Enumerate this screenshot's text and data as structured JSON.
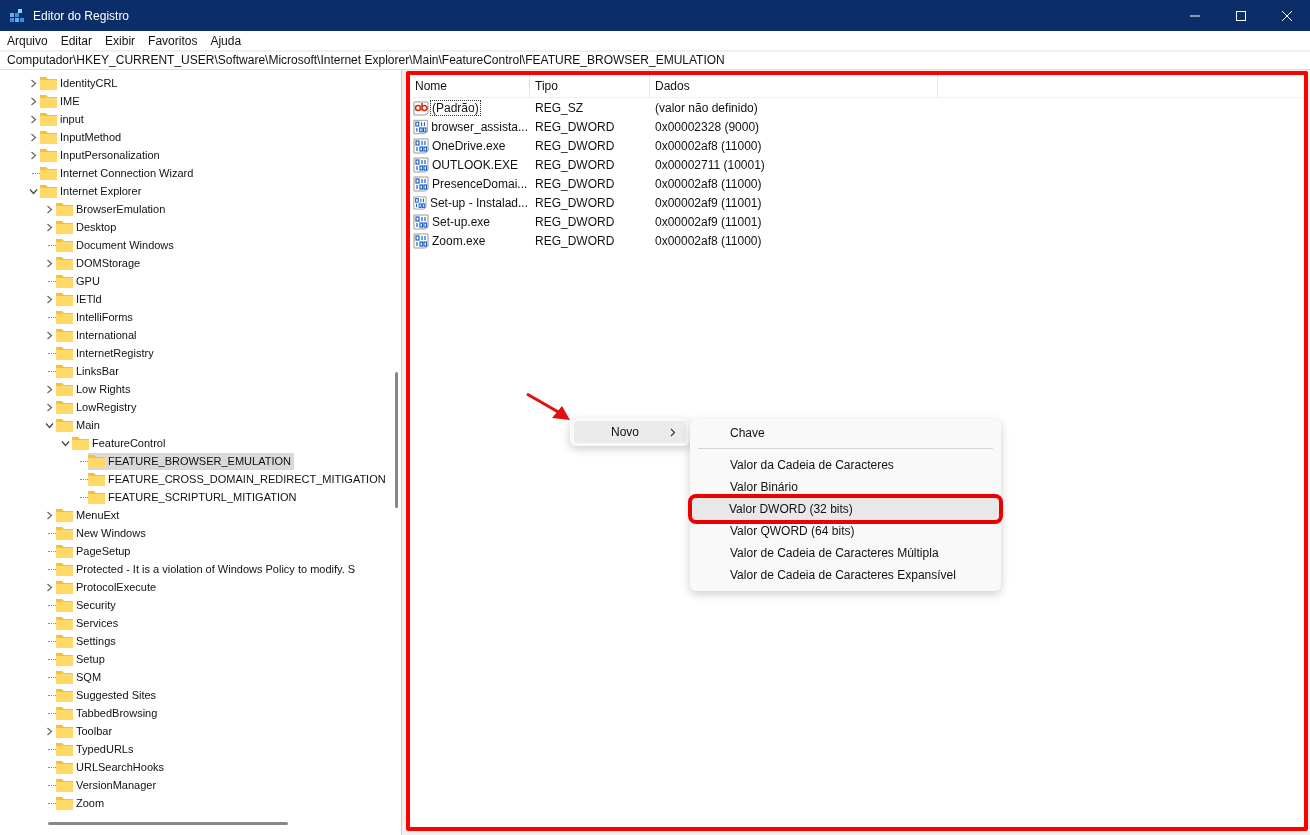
{
  "window": {
    "title": "Editor do Registro"
  },
  "menu": [
    "Arquivo",
    "Editar",
    "Exibir",
    "Favoritos",
    "Ajuda"
  ],
  "address_bar": {
    "value": "Computador\\HKEY_CURRENT_USER\\Software\\Microsoft\\Internet Explorer\\Main\\FeatureControl\\FEATURE_BROWSER_EMULATION"
  },
  "tree": [
    {
      "name": "IdentityCRL",
      "expanded": false,
      "selected": false
    },
    {
      "name": "IME",
      "expanded": false,
      "selected": false
    },
    {
      "name": "input",
      "expanded": false,
      "selected": false
    },
    {
      "name": "InputMethod",
      "expanded": false,
      "selected": false
    },
    {
      "name": "InputPersonalization",
      "expanded": false,
      "selected": false
    },
    {
      "name": "Internet Connection Wizard",
      "selected": false
    },
    {
      "name": "Internet Explorer",
      "expanded": true,
      "selected": false,
      "children": [
        {
          "name": "BrowserEmulation",
          "expanded": false,
          "selected": false
        },
        {
          "name": "Desktop",
          "expanded": false,
          "selected": false
        },
        {
          "name": "Document Windows",
          "selected": false
        },
        {
          "name": "DOMStorage",
          "expanded": false,
          "selected": false
        },
        {
          "name": "GPU",
          "selected": false
        },
        {
          "name": "IETld",
          "expanded": false,
          "selected": false
        },
        {
          "name": "IntelliForms",
          "selected": false
        },
        {
          "name": "International",
          "expanded": false,
          "selected": false
        },
        {
          "name": "InternetRegistry",
          "selected": false
        },
        {
          "name": "LinksBar",
          "selected": false
        },
        {
          "name": "Low Rights",
          "expanded": false,
          "selected": false
        },
        {
          "name": "LowRegistry",
          "expanded": false,
          "selected": false
        },
        {
          "name": "Main",
          "expanded": true,
          "selected": false,
          "children": [
            {
              "name": "FeatureControl",
              "expanded": true,
              "selected": false,
              "children": [
                {
                  "name": "FEATURE_BROWSER_EMULATION",
                  "selected": true
                },
                {
                  "name": "FEATURE_CROSS_DOMAIN_REDIRECT_MITIGATION",
                  "selected": false
                },
                {
                  "name": "FEATURE_SCRIPTURL_MITIGATION",
                  "selected": false
                }
              ]
            }
          ]
        },
        {
          "name": "MenuExt",
          "expanded": false,
          "selected": false
        },
        {
          "name": "New Windows",
          "selected": false
        },
        {
          "name": "PageSetup",
          "selected": false
        },
        {
          "name": "Protected - It is a violation of Windows Policy to modify. S",
          "selected": false
        },
        {
          "name": "ProtocolExecute",
          "expanded": false,
          "selected": false
        },
        {
          "name": "Security",
          "selected": false
        },
        {
          "name": "Services",
          "selected": false
        },
        {
          "name": "Settings",
          "selected": false
        },
        {
          "name": "Setup",
          "selected": false
        },
        {
          "name": "SQM",
          "selected": false
        },
        {
          "name": "Suggested Sites",
          "selected": false
        },
        {
          "name": "TabbedBrowsing",
          "selected": false
        },
        {
          "name": "Toolbar",
          "expanded": false,
          "selected": false
        },
        {
          "name": "TypedURLs",
          "selected": false
        },
        {
          "name": "URLSearchHooks",
          "selected": false
        },
        {
          "name": "VersionManager",
          "selected": false
        },
        {
          "name": "Zoom",
          "selected": false
        }
      ]
    }
  ],
  "values": {
    "columns": [
      "Nome",
      "Tipo",
      "Dados"
    ],
    "rows": [
      {
        "kind": "string",
        "name": "(Padrão)",
        "type": "REG_SZ",
        "data": "(valor não definido)",
        "focused": true
      },
      {
        "kind": "dword",
        "name": "browser_assista...",
        "type": "REG_DWORD",
        "data": "0x00002328 (9000)",
        "focused": false
      },
      {
        "kind": "dword",
        "name": "OneDrive.exe",
        "type": "REG_DWORD",
        "data": "0x00002af8 (11000)",
        "focused": false
      },
      {
        "kind": "dword",
        "name": "OUTLOOK.EXE",
        "type": "REG_DWORD",
        "data": "0x00002711 (10001)",
        "focused": false
      },
      {
        "kind": "dword",
        "name": "PresenceDomai...",
        "type": "REG_DWORD",
        "data": "0x00002af8 (11000)",
        "focused": false
      },
      {
        "kind": "dword",
        "name": "Set-up - Instalad...",
        "type": "REG_DWORD",
        "data": "0x00002af9 (11001)",
        "focused": false
      },
      {
        "kind": "dword",
        "name": "Set-up.exe",
        "type": "REG_DWORD",
        "data": "0x00002af9 (11001)",
        "focused": false
      },
      {
        "kind": "dword",
        "name": "Zoom.exe",
        "type": "REG_DWORD",
        "data": "0x00002af8 (11000)",
        "focused": false
      }
    ]
  },
  "context_menu": {
    "items": [
      {
        "label": "Novo",
        "selected": true
      }
    ],
    "submenu": [
      {
        "kind": "item",
        "label": "Chave",
        "selected": false,
        "annotated": false
      },
      {
        "kind": "separator"
      },
      {
        "kind": "item",
        "label": "Valor da Cadeia de Caracteres",
        "selected": false,
        "annotated": false
      },
      {
        "kind": "item",
        "label": "Valor Binário",
        "selected": false,
        "annotated": false
      },
      {
        "kind": "item",
        "label": "Valor DWORD (32 bits)",
        "selected": true,
        "annotated": true
      },
      {
        "kind": "item",
        "label": "Valor QWORD (64 bits)",
        "selected": false,
        "annotated": false
      },
      {
        "kind": "item",
        "label": "Valor de Cadeia de Caracteres Múltipla",
        "selected": false,
        "annotated": false
      },
      {
        "kind": "item",
        "label": "Valor de Cadeia de Caracteres Expansível",
        "selected": false,
        "annotated": false
      }
    ]
  }
}
